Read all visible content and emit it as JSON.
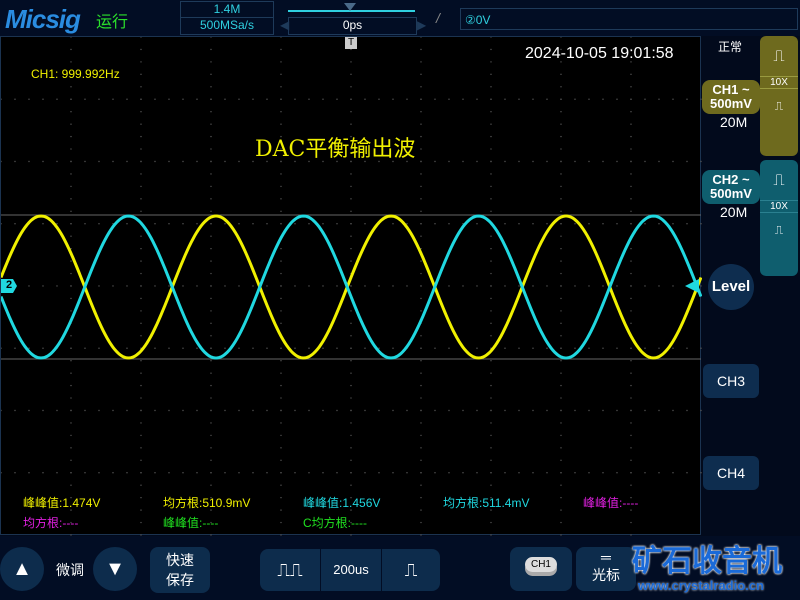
{
  "header": {
    "brand": "Micsig",
    "run_state": "运行",
    "memory_depth": "1.4M",
    "sample_rate": "500MSa/s",
    "time_offset": "0ps",
    "trigger_edge": "/",
    "trigger_level": "②0V"
  },
  "screen": {
    "timestamp": "2024-10-05 19:01:58",
    "frequency": "CH1: 999.992Hz",
    "title": "DAC平衡输出波",
    "ch2_marker": "2"
  },
  "sidebar": {
    "acq_mode": "正常",
    "ch1": {
      "name": "CH1 ~",
      "scale": "500mV",
      "bandwidth": "20M",
      "probe": "10X",
      "color": "#6e6a1e"
    },
    "ch2": {
      "name": "CH2 ~",
      "scale": "500mV",
      "bandwidth": "20M",
      "probe": "10X",
      "color": "#0f5e6e"
    },
    "level": "Level",
    "ch3": "CH3",
    "ch4": "CH4"
  },
  "measurements": [
    {
      "label": "峰峰值:1.474V",
      "color": "#f0f000"
    },
    {
      "label": "均方根:510.9mV",
      "color": "#f0f000"
    },
    {
      "label": "峰峰值:1.456V",
      "color": "#20d8e0"
    },
    {
      "label": "均方根:511.4mV",
      "color": "#20d8e0"
    },
    {
      "label": "峰峰值:----",
      "color": "#e020e0"
    },
    {
      "label": "均方根:----",
      "color": "#e020e0"
    },
    {
      "label": "峰峰值:----",
      "color": "#20e020"
    },
    {
      "label": "C均方根:----",
      "color": "#20e020"
    }
  ],
  "bottom": {
    "fine_label": "微调",
    "quick_save_1": "快速",
    "quick_save_2": "保存",
    "timebase": "200us",
    "ch1_badge": "CH1",
    "cursor": "光标",
    "watermark": "矿石收音机",
    "watermark_url": "www.crystalradio.cn"
  },
  "waves": {
    "ch1_color": "#f0f000",
    "ch2_color": "#20d8e0",
    "period_div": 2.5,
    "amplitude_div": 1.15
  }
}
